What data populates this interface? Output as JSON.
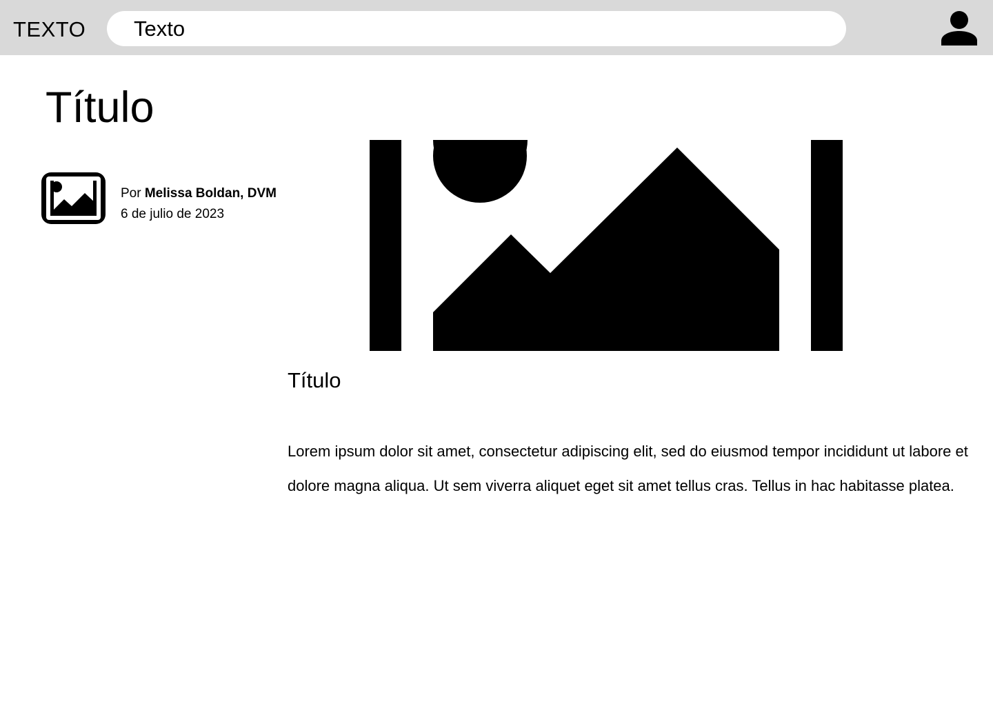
{
  "header": {
    "logo_text": "TEXTO",
    "search_value": "Texto",
    "user_icon": "user-icon"
  },
  "article": {
    "title": "Título",
    "author_prefix": "Por",
    "author_name": "Melissa Boldan, DVM",
    "date": "6 de julio de 2023",
    "avatar_icon": "image-icon",
    "hero_icon": "image-placeholder-icon",
    "section_title": "Título",
    "body": "Lorem ipsum dolor sit amet, consectetur adipiscing elit, sed do eiusmod tempor incididunt ut labore et dolore magna aliqua. Ut sem viverra aliquet eget sit amet tellus cras. Tellus in hac habitasse platea."
  },
  "colors": {
    "header_bg": "#d9d9d9",
    "page_bg": "#ffffff",
    "text": "#000000"
  }
}
